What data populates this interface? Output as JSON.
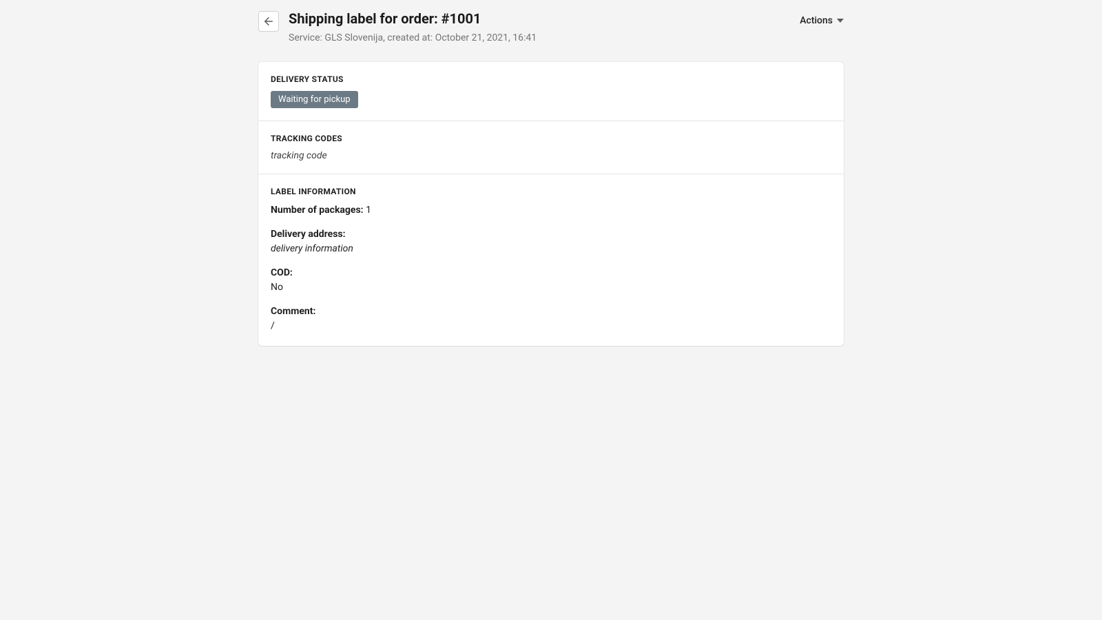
{
  "header": {
    "title": "Shipping label for order: #1001",
    "subtitle": "Service: GLS Slovenija, created at: October 21, 2021, 16:41",
    "actions_label": "Actions"
  },
  "delivery_status": {
    "heading": "DELIVERY STATUS",
    "badge": "Waiting for pickup"
  },
  "tracking": {
    "heading": "TRACKING CODES",
    "value": "tracking code"
  },
  "label_info": {
    "heading": "LABEL INFORMATION",
    "packages_label": "Number of packages: ",
    "packages_value": "1",
    "address_label": "Delivery address:",
    "address_value": "delivery information",
    "cod_label": "COD:",
    "cod_value": "No",
    "comment_label": "Comment:",
    "comment_value": "/"
  }
}
